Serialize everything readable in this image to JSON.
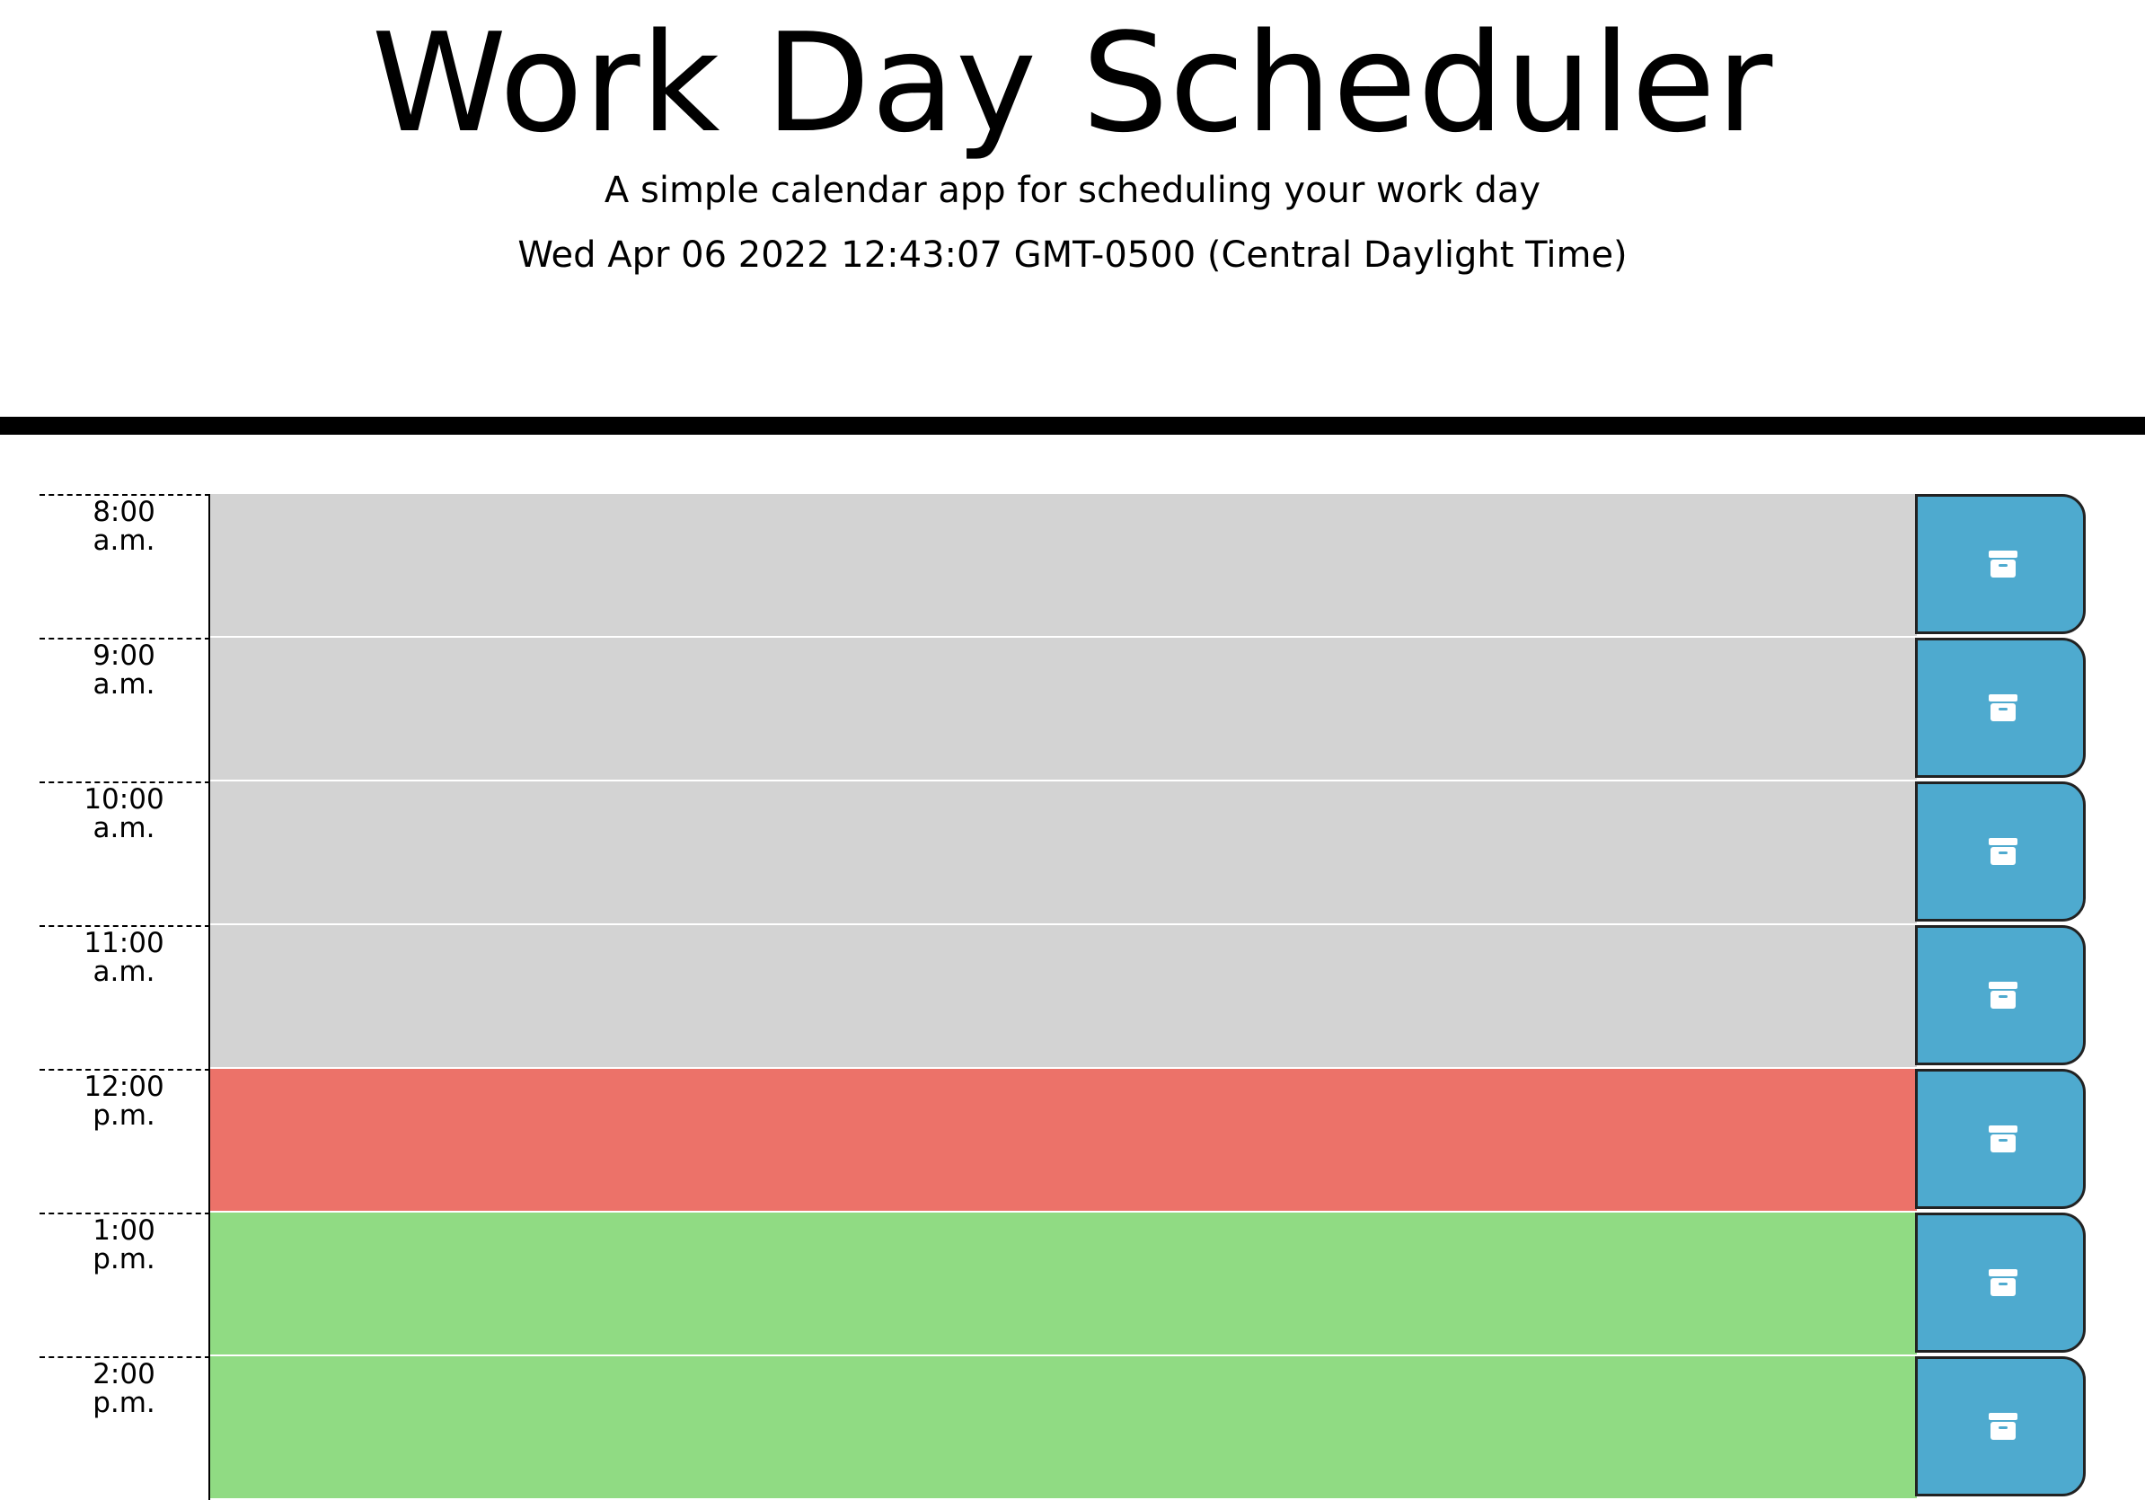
{
  "header": {
    "title": "Work Day Scheduler",
    "subtitle": "A simple calendar app for scheduling your work day",
    "current_datetime": "Wed Apr 06 2022 12:43:07 GMT-0500 (Central Daylight Time)"
  },
  "colors": {
    "past": "#d3d3d3",
    "present": "#ec7269",
    "future": "#90db83",
    "save_button": "#4eaacf"
  },
  "rows": [
    {
      "time": "8:00",
      "period": "a.m.",
      "status": "past",
      "text": "",
      "save_icon": "archive-icon"
    },
    {
      "time": "9:00",
      "period": "a.m.",
      "status": "past",
      "text": "",
      "save_icon": "archive-icon"
    },
    {
      "time": "10:00",
      "period": "a.m.",
      "status": "past",
      "text": "",
      "save_icon": "archive-icon"
    },
    {
      "time": "11:00",
      "period": "a.m.",
      "status": "past",
      "text": "",
      "save_icon": "archive-icon"
    },
    {
      "time": "12:00",
      "period": "p.m.",
      "status": "present",
      "text": "",
      "save_icon": "archive-icon"
    },
    {
      "time": "1:00",
      "period": "p.m.",
      "status": "future",
      "text": "",
      "save_icon": "archive-icon"
    },
    {
      "time": "2:00",
      "period": "p.m.",
      "status": "future",
      "text": "",
      "save_icon": "archive-icon"
    }
  ]
}
